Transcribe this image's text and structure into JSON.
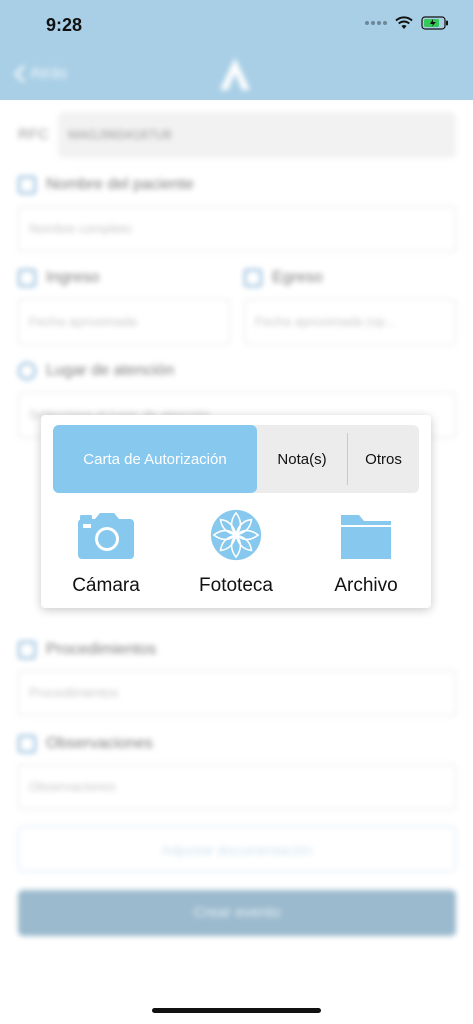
{
  "status": {
    "time": "9:28"
  },
  "nav": {
    "back_label": "Atrás"
  },
  "form": {
    "rfc_label": "RFC",
    "rfc_value": "MAGJ9604187U8",
    "patient_label": "Nombre del paciente",
    "patient_placeholder": "Nombre completo",
    "ingreso_label": "Ingreso",
    "ingreso_placeholder": "Fecha aproximada",
    "egreso_label": "Egreso",
    "egreso_placeholder": "Fecha aproximada (op...",
    "lugar_label": "Lugar de atención",
    "lugar_placeholder": "Selecciona el lugar de atención",
    "procedimientos_label": "Procedimientos",
    "procedimientos_placeholder": "Procedimientos",
    "observaciones_label": "Observaciones",
    "observaciones_placeholder": "Observaciones",
    "attach_label": "Adjuntar documentación",
    "create_label": "Crear evento"
  },
  "popup": {
    "tabs": [
      "Carta de Autorización",
      "Nota(s)",
      "Otros"
    ],
    "options": [
      {
        "label": "Cámara",
        "icon": "camera-icon"
      },
      {
        "label": "Fototeca",
        "icon": "photo-library-icon"
      },
      {
        "label": "Archivo",
        "icon": "folder-icon"
      }
    ]
  },
  "colors": {
    "accent": "#87c8ee",
    "header": "#a9cfe6",
    "create_button": "#9bbacd"
  }
}
